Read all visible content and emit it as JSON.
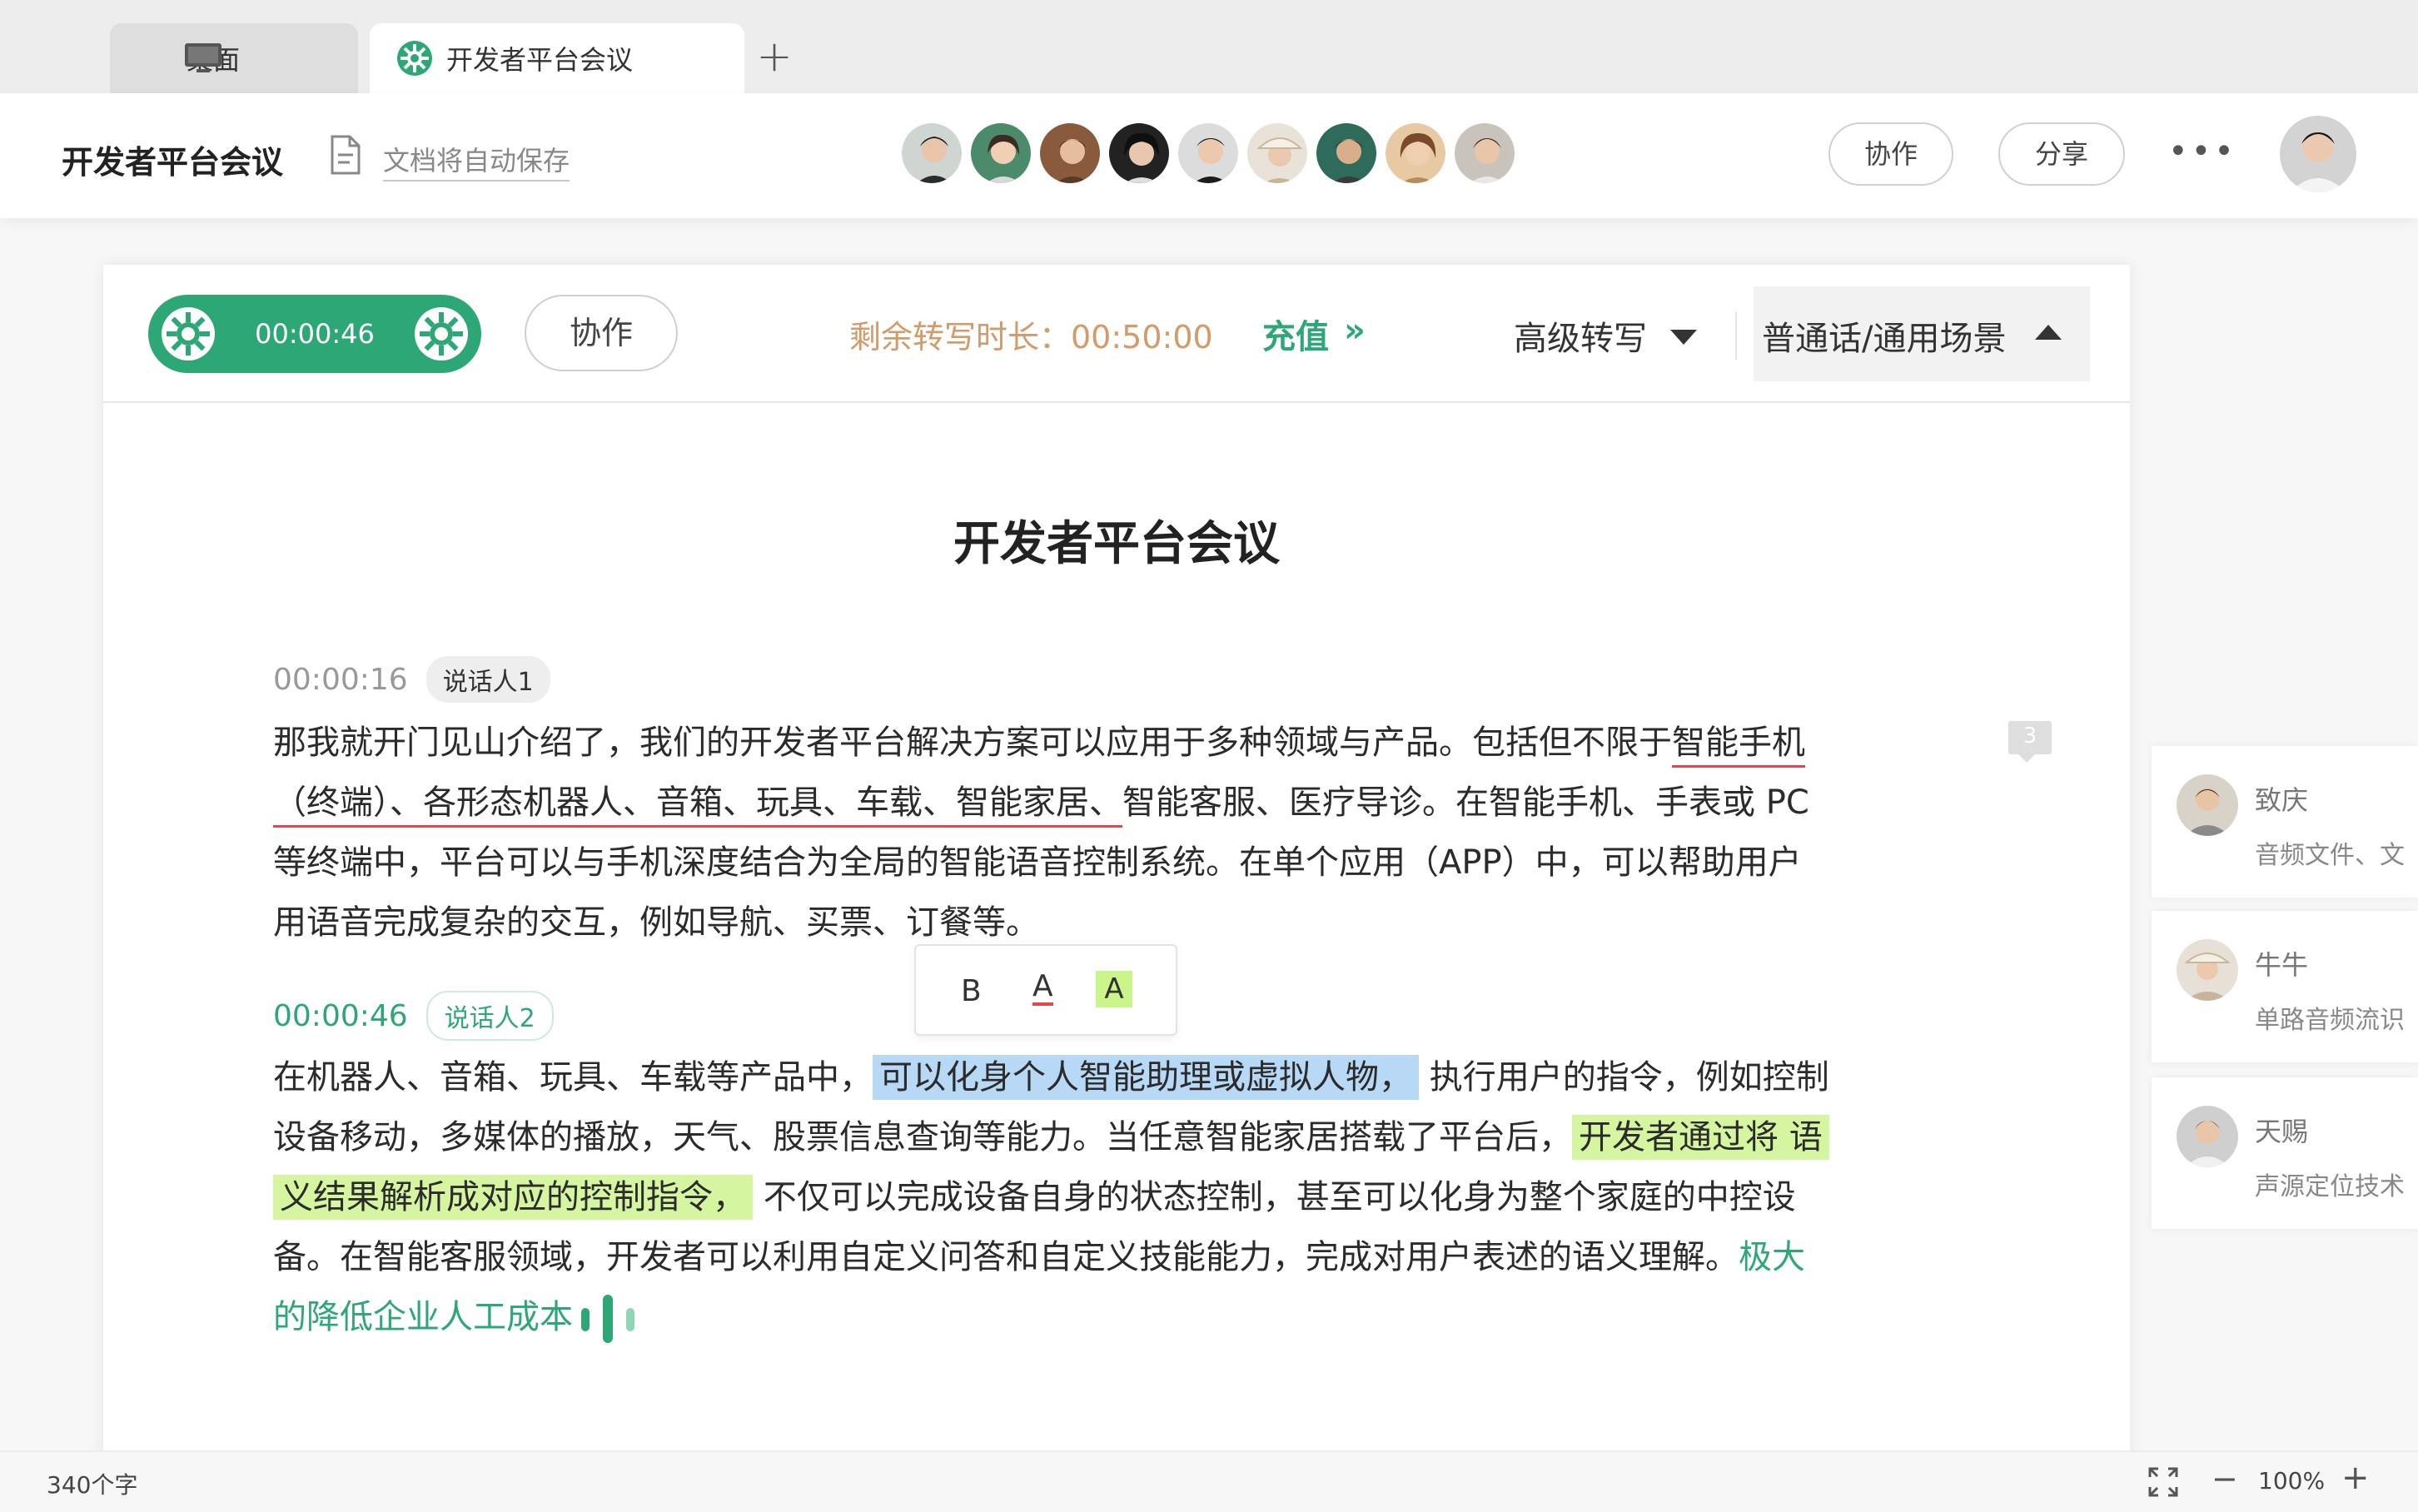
{
  "tabs": [
    {
      "label": "桌面",
      "icon": "monitor-icon"
    },
    {
      "label": "开发者平台会议",
      "icon": "app-gear-icon"
    }
  ],
  "header": {
    "title": "开发者平台会议",
    "autosave": "文档将自动保存",
    "collab_label": "协作",
    "share_label": "分享",
    "more_label": "•••"
  },
  "toolbar": {
    "record_time": "00:00:46",
    "collab_label": "协作",
    "remain_label": "剩余转写时长：00:50:00",
    "recharge_label": "充值",
    "recharge_icon": "»",
    "advanced_label": "高级转写",
    "language_label": "普通话/通用场景"
  },
  "doc": {
    "title": "开发者平台会议",
    "segments": [
      {
        "time": "00:00:16",
        "speaker": "说话人1",
        "lines": {
          "l1a": "那我就开门见山介绍了，我们的开发者平台解决方案可以应用于多种领域与产品。包括但不限于",
          "l1b": "智能手机",
          "l2a": "（终端）、各形态机器人、音箱、玩具、车载、智能家居、",
          "l2b": "智能客服、医疗导诊。在智能手机、手表或 PC",
          "l3": "等终端中，平台可以与手机深度结合为全局的智能语音控制系统。在单个应用（APP）中，可以帮助用户",
          "l4": "用语音完成复杂的交互，例如导航、买票、订餐等。"
        }
      },
      {
        "time": "00:00:46",
        "speaker": "说话人2",
        "lines": {
          "l1a": "在机器人、音箱、玩具、车载等产品中，",
          "l1b": "可以化身个人智能助理或虚拟人物，",
          "l1c": " 执行用户的指令，例如控制",
          "l2a": "设备移动，多媒体的播放，天气、股票信息查询等能力。当任意智能家居搭载了平台后，",
          "l2b": "开发者通过将 语",
          "l3a": "义结果解析成对应的控制指令，",
          "l3b": " 不仅可以完成设备自身的状态控制，甚至可以化身为整个家庭的中控设",
          "l4a": "备。在智能客服领域，开发者可以利用自定义问答和自定义技能能力，完成对用户表述的语义理解。",
          "l4b": "极大",
          "l5": "的降低企业人工成本"
        }
      }
    ],
    "comment_count": "3"
  },
  "format_popup": {
    "bold": "B",
    "color": "A",
    "highlight": "A"
  },
  "comments": [
    {
      "name": "致庆",
      "text": "音频文件、文"
    },
    {
      "name": "牛牛",
      "text": "单路音频流识"
    },
    {
      "name": "天赐",
      "text": "声源定位技术"
    }
  ],
  "status": {
    "word_count": "340个字",
    "zoom_minus": "−",
    "zoom": "100%",
    "zoom_plus": "+"
  },
  "colors": {
    "accent": "#2ea776",
    "remain": "#d39a6a",
    "underline": "#e6454a",
    "highlight_blue": "#b8d9f5",
    "highlight_green": "#d6f5a0"
  }
}
